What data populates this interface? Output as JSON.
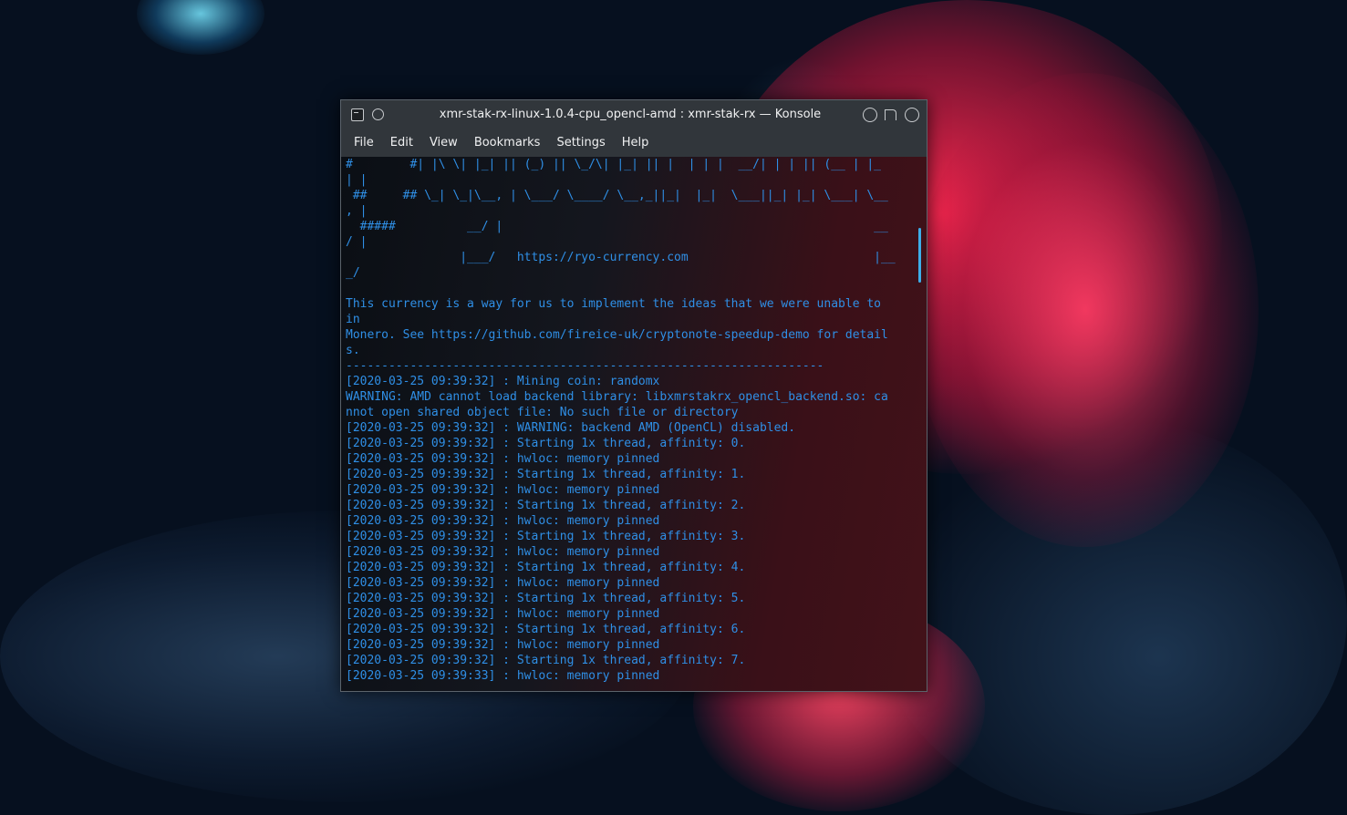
{
  "window": {
    "title": "xmr-stak-rx-linux-1.0.4-cpu_opencl-amd : xmr-stak-rx — Konsole"
  },
  "menu": {
    "items": [
      "File",
      "Edit",
      "View",
      "Bookmarks",
      "Settings",
      "Help"
    ]
  },
  "terminal": {
    "lines": [
      "#        #| |\\ \\| |_| || (_) || \\_/\\| |_| || |  | | |  __/| | | || (__ | |_",
      "| |",
      " ##     ## \\_| \\_|\\__, | \\___/ \\____/ \\__,_||_|  |_|  \\___||_| |_| \\___| \\__",
      ", |",
      "  #####          __/ |                                                    __",
      "/ |",
      "                |___/   https://ryo-currency.com                          |__",
      "_/",
      "",
      "This currency is a way for us to implement the ideas that we were unable to",
      "in",
      "Monero. See https://github.com/fireice-uk/cryptonote-speedup-demo for detail",
      "s.",
      "-------------------------------------------------------------------",
      "[2020-03-25 09:39:32] : Mining coin: randomx",
      "WARNING: AMD cannot load backend library: libxmrstakrx_opencl_backend.so: ca",
      "nnot open shared object file: No such file or directory",
      "[2020-03-25 09:39:32] : WARNING: backend AMD (OpenCL) disabled.",
      "[2020-03-25 09:39:32] : Starting 1x thread, affinity: 0.",
      "[2020-03-25 09:39:32] : hwloc: memory pinned",
      "[2020-03-25 09:39:32] : Starting 1x thread, affinity: 1.",
      "[2020-03-25 09:39:32] : hwloc: memory pinned",
      "[2020-03-25 09:39:32] : Starting 1x thread, affinity: 2.",
      "[2020-03-25 09:39:32] : hwloc: memory pinned",
      "[2020-03-25 09:39:32] : Starting 1x thread, affinity: 3.",
      "[2020-03-25 09:39:32] : hwloc: memory pinned",
      "[2020-03-25 09:39:32] : Starting 1x thread, affinity: 4.",
      "[2020-03-25 09:39:32] : hwloc: memory pinned",
      "[2020-03-25 09:39:32] : Starting 1x thread, affinity: 5.",
      "[2020-03-25 09:39:32] : hwloc: memory pinned",
      "[2020-03-25 09:39:32] : Starting 1x thread, affinity: 6.",
      "[2020-03-25 09:39:32] : hwloc: memory pinned",
      "[2020-03-25 09:39:32] : Starting 1x thread, affinity: 7.",
      "[2020-03-25 09:39:33] : hwloc: memory pinned"
    ]
  },
  "colors": {
    "terminal_text": "#2f8fe6",
    "accent": "#3daee9",
    "titlebar": "#31363b"
  },
  "icons": {
    "app": "konsole-app-icon",
    "pin": "keep-on-top-icon",
    "minimize": "minimize-icon",
    "maximize": "maximize-icon",
    "close": "close-icon"
  }
}
